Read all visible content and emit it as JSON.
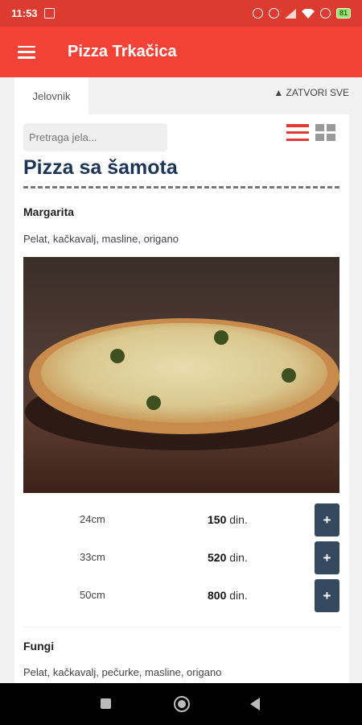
{
  "status_bar": {
    "time": "11:53",
    "battery": "81"
  },
  "app_bar": {
    "title": "Pizza Trkačica"
  },
  "tabs": {
    "active_label": "Jelovnik",
    "close_all_label": "▲ ZATVORI SVE"
  },
  "search": {
    "placeholder": "Pretraga jela..."
  },
  "category": {
    "title": "Pizza sa šamota"
  },
  "items": [
    {
      "name": "Margarita",
      "description": "Pelat, kačkavalj, masline, origano",
      "prices": [
        {
          "size": "24cm",
          "amount": "150",
          "currency": "din."
        },
        {
          "size": "33cm",
          "amount": "520",
          "currency": "din."
        },
        {
          "size": "50cm",
          "amount": "800",
          "currency": "din."
        }
      ],
      "add_label": "+"
    },
    {
      "name": "Fungi",
      "description": "Pelat, kačkavalj, pečurke, masline, origano"
    }
  ],
  "colors": {
    "status_bar": "#de3b30",
    "app_bar": "#f44336",
    "category_title": "#1d3557",
    "add_button": "#34495e",
    "list_icon": "#e53935"
  }
}
